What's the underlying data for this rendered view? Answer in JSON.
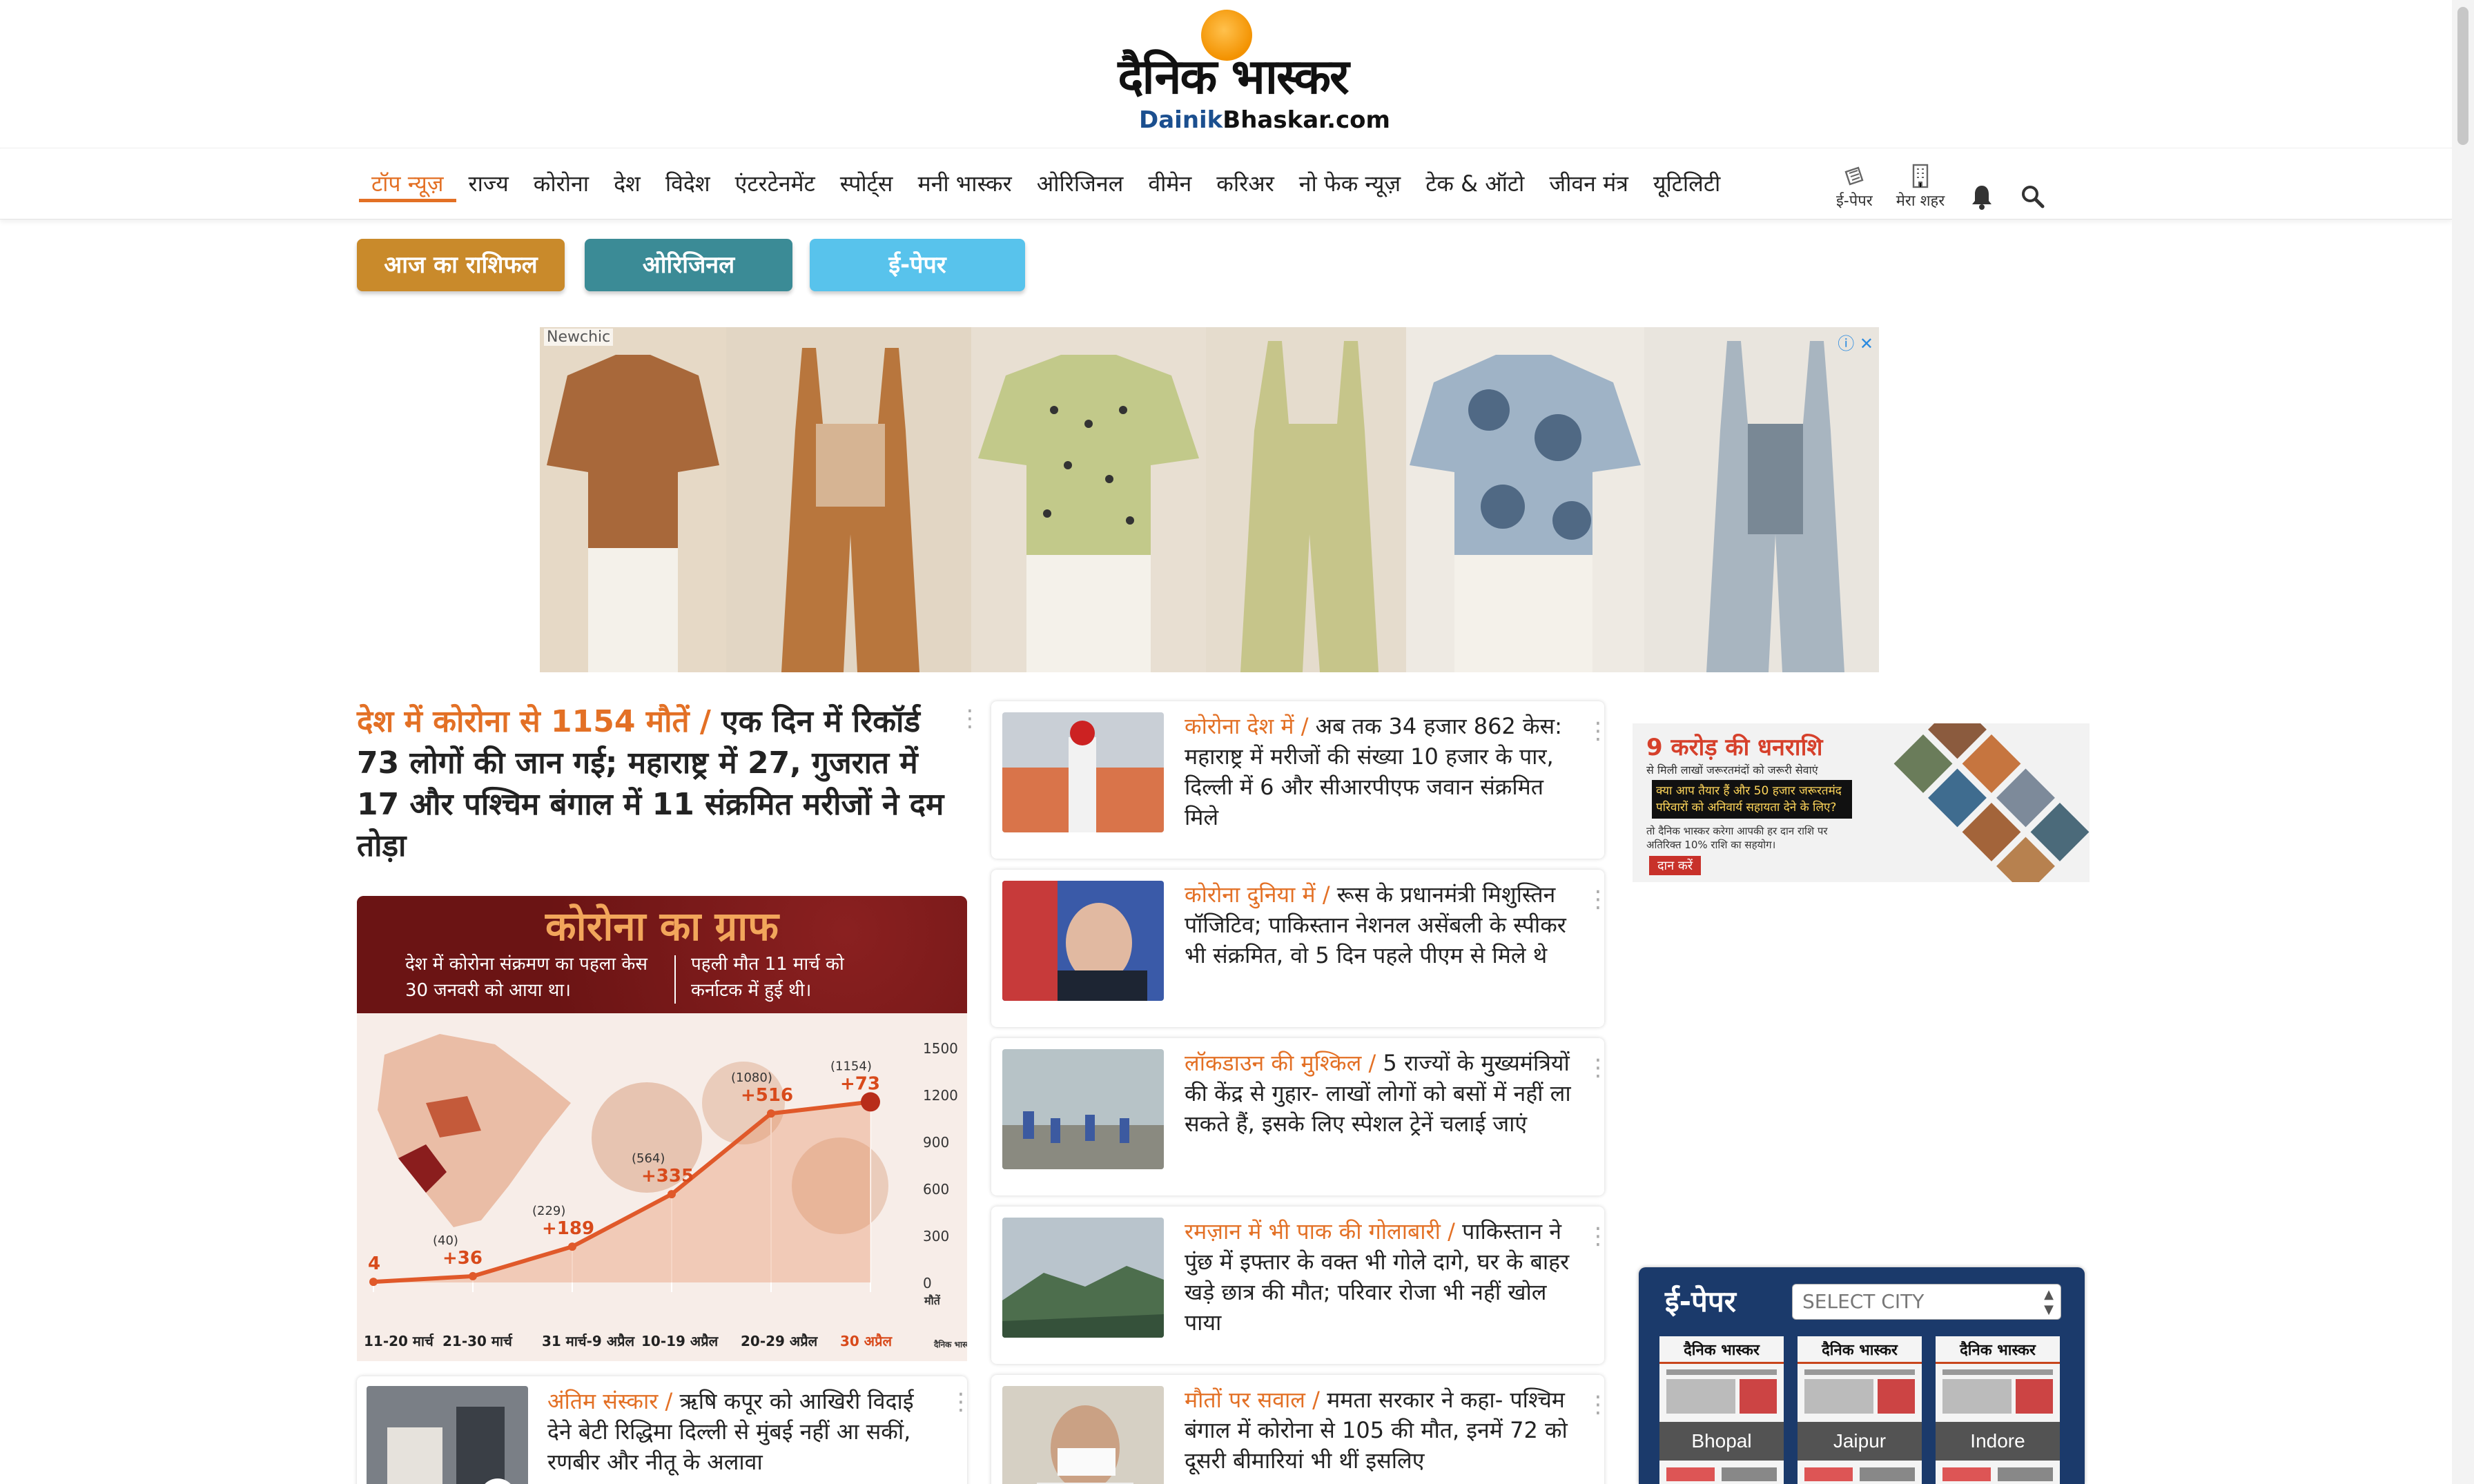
{
  "header": {
    "logo_hindi": "दैनिक भास्कर",
    "logo_eng_accent": "Dainik",
    "logo_eng_rest": "Bhaskar.com"
  },
  "nav": {
    "items": [
      "टॉप न्यूज़",
      "राज्य",
      "कोरोना",
      "देश",
      "विदेश",
      "एंटरटेनमेंट",
      "स्पोर्ट्स",
      "मनी भास्कर",
      "ओरिजिनल",
      "वीमेन",
      "करिअर",
      "नो फेक न्यूज़",
      "टेक & ऑटो",
      "जीवन मंत्र",
      "यूटिलिटी"
    ],
    "active_index": 0,
    "epaper_label": "ई-पेपर",
    "city_label": "मेरा शहर",
    "bell_icon": "bell-icon",
    "search_icon": "search-icon"
  },
  "quick_buttons": {
    "rashifal": "आज का राशिफल",
    "original": "ओरिजिनल",
    "epaper": "ई-पेपर"
  },
  "ad": {
    "brand": "Newchic",
    "close": "ⓘ ✕"
  },
  "lead": {
    "kicker": "देश में कोरोना से 1154 मौतें /",
    "headline": " एक दिन में रिकॉर्ड 73 लोगों की जान गई; महाराष्ट्र में 27, गुजरात में 17 और पश्चिम बंगाल में 11 संक्रमित मरीजों ने दम तोड़ा"
  },
  "graph": {
    "title": "कोरोना का ग्राफ",
    "note_left": "देश में कोरोना संक्रमण का पहला केस 30 जनवरी को आया था।",
    "note_right": "पहली मौत 11 मार्च को कर्नाटक में हुई थी।",
    "y_ticks": [
      "1500",
      "1200",
      "900",
      "600",
      "300",
      "0"
    ],
    "y_unit": "मौतें",
    "x_labels": [
      "11-20 मार्च",
      "21-30 मार्च",
      "31 मार्च-9 अप्रैल",
      "10-19 अप्रैल",
      "20-29 अप्रैल",
      "30 अप्रैल"
    ],
    "points": [
      {
        "total": "",
        "added": "4"
      },
      {
        "total": "(40)",
        "added": "+36"
      },
      {
        "total": "(229)",
        "added": "+189"
      },
      {
        "total": "(564)",
        "added": "+335"
      },
      {
        "total": "(1080)",
        "added": "+516"
      },
      {
        "total": "(1154)",
        "added": "+73"
      }
    ],
    "brand": "दैनिक भास्कर"
  },
  "chart_data": {
    "type": "line",
    "title": "कोरोना का ग्राफ",
    "categories": [
      "11-20 मार्च",
      "21-30 मार्च",
      "31 मार्च-9 अप्रैल",
      "10-19 अप्रैल",
      "20-29 अप्रैल",
      "30 अप्रैल"
    ],
    "values": [
      4,
      40,
      229,
      564,
      1080,
      1154
    ],
    "increments": [
      4,
      36,
      189,
      335,
      516,
      73
    ],
    "ylim": [
      0,
      1500
    ],
    "ylabel": "मौतें"
  },
  "cards": [
    {
      "kicker": "कोरोना देश में /",
      "text": " अब तक 34 हजार 862 केस: महाराष्ट्र में मरीजों की संख्या 10 हजार के पार, दिल्ली में 6 और सीआरपीएफ जवान संक्रमित मिले"
    },
    {
      "kicker": "कोरोना दुनिया में /",
      "text": " रूस के प्रधानमंत्री मिशुस्तिन पॉजिटिव; पाकिस्तान नेशनल असेंबली के स्पीकर भी संक्रमित, वो 5 दिन पहले पीएम से मिले थे"
    },
    {
      "kicker": "लॉकडाउन की मुश्किल /",
      "text": " 5 राज्यों के मुख्यमंत्रियों की केंद्र से गुहार- लाखों लोगों को बसों में नहीं ला सकते हैं, इसके लिए स्पेशल ट्रेनें चलाई जाएं"
    },
    {
      "kicker": "रमज़ान में भी पाक की गोलाबारी /",
      "text": " पाकिस्तान ने पुंछ में इफ्तार के वक्त भी गोले दागे, घर के बाहर खड़े छात्र की मौत; परिवार रोजा भी नहीं खोल पाया"
    },
    {
      "kicker": "मौतों पर सवाल /",
      "text": " ममता सरकार ने कहा- पश्चिम बंगाल में कोरोना से 105 की मौत, इनमें 72 को दूसरी बीमारियां भी थीं इसलिए"
    }
  ],
  "left_card": {
    "kicker": "अंतिम संस्कार /",
    "text": " ऋषि कपूर को आखिरी विदाई देने बेटी रिद्धिमा दिल्ली से मुंबई नहीं आ सकीं, रणबीर और नीतू के अलावा"
  },
  "donation_ad": {
    "title": "9 करोड़ की धनराशि",
    "sub": "से मिली लाखों जरूरतमंदों को जरूरी सेवाएं",
    "question": "क्या आप तैयार हैं और 50 हजार जरूरतमंद परिवारों को अनिवार्य सहायता देने के लिए?",
    "note": "तो दैनिक भास्कर करेगा आपकी हर दान राशि पर अतिरिक्त 10% राशि का सहयोग।",
    "button": "दान करें"
  },
  "epaper": {
    "title": "ई-पेपर",
    "select_placeholder": "SELECT CITY",
    "paper_name": "दैनिक भास्कर",
    "cities": [
      "Bhopal",
      "Jaipur",
      "Indore"
    ]
  }
}
